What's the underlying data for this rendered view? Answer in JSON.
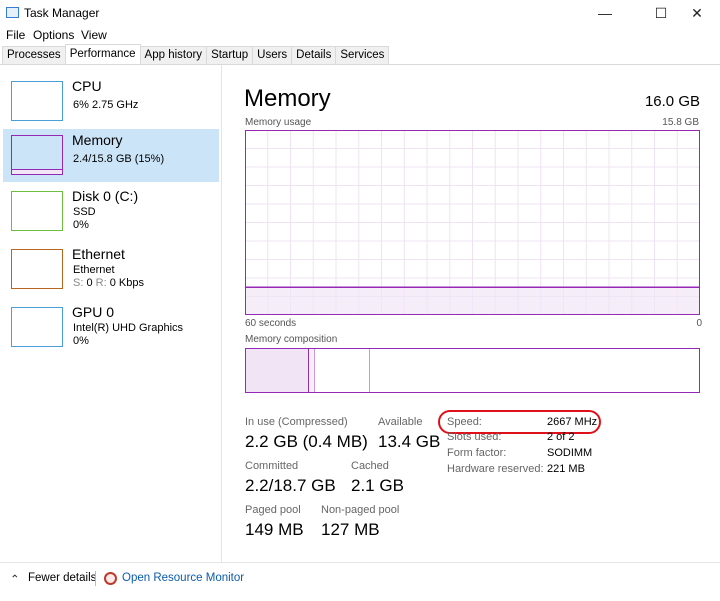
{
  "window": {
    "title": "Task Manager",
    "minimize_icon": "minimize-icon",
    "maximize_icon": "maximize-icon",
    "close_icon": "close-icon"
  },
  "menu": [
    "File",
    "Options",
    "View"
  ],
  "tabs": [
    "Processes",
    "Performance",
    "App history",
    "Startup",
    "Users",
    "Details",
    "Services"
  ],
  "active_tab": "Performance",
  "sidebar": [
    {
      "name": "CPU",
      "lines": [
        "6%  2.75 GHz"
      ],
      "color": "#4a9fd8"
    },
    {
      "name": "Memory",
      "lines": [
        "2.4/15.8 GB (15%)"
      ],
      "color": "#9528b4",
      "selected": true,
      "usage_fraction": 0.15
    },
    {
      "name": "Disk 0 (C:)",
      "lines": [
        "SSD",
        "0%"
      ],
      "color": "#6cbf3c"
    },
    {
      "name": "Ethernet",
      "lines": [
        "Ethernet"
      ],
      "color": "#b8651f",
      "throughput": {
        "s_label": "S:",
        "s": "0",
        "r_label": "R:",
        "r": "0 Kbps"
      }
    },
    {
      "name": "GPU 0",
      "lines": [
        "Intel(R) UHD Graphics",
        "0%"
      ],
      "color": "#4a9fd8"
    }
  ],
  "main": {
    "title": "Memory",
    "total": "16.0 GB",
    "usage_label": "Memory usage",
    "usage_max": "15.8 GB",
    "x_left": "60 seconds",
    "x_right": "0",
    "usage_fraction": 0.15,
    "composition_label": "Memory composition",
    "stats": {
      "in_use_label": "In use (Compressed)",
      "in_use": "2.2 GB (0.4 MB)",
      "available_label": "Available",
      "available": "13.4 GB",
      "committed_label": "Committed",
      "committed": "2.2/18.7 GB",
      "cached_label": "Cached",
      "cached": "2.1 GB",
      "paged_label": "Paged pool",
      "paged": "149 MB",
      "nonpaged_label": "Non-paged pool",
      "nonpaged": "127 MB"
    },
    "details": [
      {
        "label": "Speed:",
        "value": "2667 MHz",
        "highlighted": true
      },
      {
        "label": "Slots used:",
        "value": "2 of 2"
      },
      {
        "label": "Form factor:",
        "value": "SODIMM"
      },
      {
        "label": "Hardware reserved:",
        "value": "221 MB"
      }
    ],
    "accent": "#9528b4",
    "highlight_color": "#e0101a"
  },
  "footer": {
    "fewer_details": "Fewer details",
    "open_monitor": "Open Resource Monitor"
  }
}
